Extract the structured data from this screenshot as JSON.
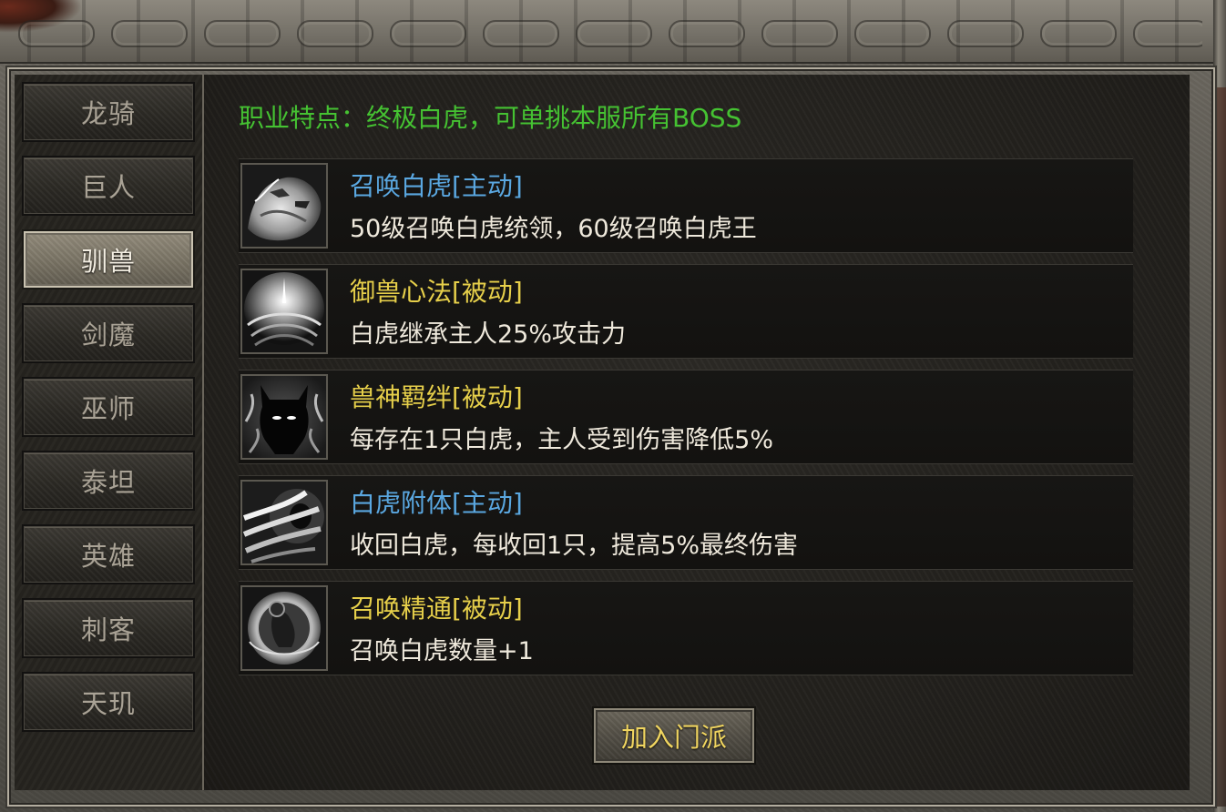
{
  "sidebar": {
    "tabs": [
      {
        "label": "龙骑",
        "active": false
      },
      {
        "label": "巨人",
        "active": false
      },
      {
        "label": "驯兽",
        "active": true
      },
      {
        "label": "剑魔",
        "active": false
      },
      {
        "label": "巫师",
        "active": false
      },
      {
        "label": "泰坦",
        "active": false
      },
      {
        "label": "英雄",
        "active": false
      },
      {
        "label": "刺客",
        "active": false
      },
      {
        "label": "天玑",
        "active": false
      }
    ]
  },
  "main": {
    "feature_text": "职业特点：终极白虎，可单挑本服所有BOSS",
    "skills": [
      {
        "name": "召唤白虎[主动]",
        "desc": "50级召唤白虎统领，60级召唤白虎王",
        "type": "active",
        "icon": "white-tiger-icon"
      },
      {
        "name": "御兽心法[被动]",
        "desc": "白虎继承主人25%攻击力",
        "type": "passive",
        "icon": "swirl-light-icon"
      },
      {
        "name": "兽神羁绊[被动]",
        "desc": "每存在1只白虎，主人受到伤害降低5%",
        "type": "passive",
        "icon": "shadow-beast-icon"
      },
      {
        "name": "白虎附体[主动]",
        "desc": "收回白虎，每收回1只，提高5%最终伤害",
        "type": "active",
        "icon": "claw-slash-icon"
      },
      {
        "name": "召唤精通[被动]",
        "desc": "召唤白虎数量+1",
        "type": "passive",
        "icon": "summon-circle-icon"
      }
    ],
    "join_button_label": "加入门派"
  },
  "colors": {
    "feature_text": "#45c232",
    "active_skill": "#5aa7e0",
    "passive_skill": "#e6cf4a",
    "button_text": "#f0d560"
  }
}
